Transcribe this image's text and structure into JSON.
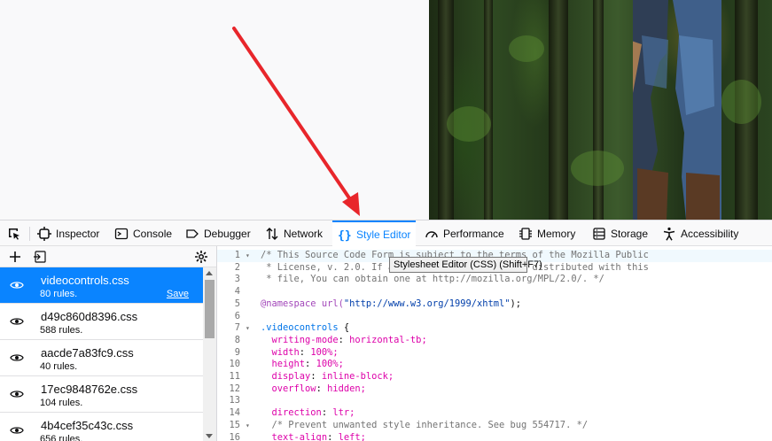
{
  "toolbar": {
    "tabs": [
      {
        "label": "Inspector",
        "icon": "inspector-icon"
      },
      {
        "label": "Console",
        "icon": "console-icon"
      },
      {
        "label": "Debugger",
        "icon": "debugger-icon"
      },
      {
        "label": "Network",
        "icon": "network-icon"
      },
      {
        "label": "Style Editor",
        "icon": "style-editor-icon",
        "selected": true
      },
      {
        "label": "Performance",
        "icon": "performance-icon"
      },
      {
        "label": "Memory",
        "icon": "memory-icon"
      },
      {
        "label": "Storage",
        "icon": "storage-icon"
      },
      {
        "label": "Accessibility",
        "icon": "accessibility-icon"
      }
    ]
  },
  "tooltip": {
    "text": "Stylesheet Editor (CSS) (Shift+F7)"
  },
  "sidebar": {
    "sheets": [
      {
        "name": "videocontrols.css",
        "rules": "80 rules.",
        "save": "Save",
        "selected": true
      },
      {
        "name": "d49c860d8396.css",
        "rules": "588 rules."
      },
      {
        "name": "aacde7a83fc9.css",
        "rules": "40 rules."
      },
      {
        "name": "17ec9848762e.css",
        "rules": "104 rules."
      },
      {
        "name": "4b4cef35c43c.css",
        "rules": "656 rules."
      }
    ]
  },
  "editor": {
    "lines": [
      {
        "n": "1",
        "text": "/* This Source Code Form is subject to the terms of the Mozilla Public"
      },
      {
        "n": "2",
        "text": " * License, v. 2.0. If a copy of the MPL was not distributed with this"
      },
      {
        "n": "3",
        "text": " * file, You can obtain one at http://mozilla.org/MPL/2.0/. */"
      },
      {
        "n": "4",
        "text": ""
      },
      {
        "n": "5",
        "at": "@namespace url(",
        "str": "\"http://www.w3.org/1999/xhtml\"",
        "tail": ");"
      },
      {
        "n": "6",
        "text": ""
      },
      {
        "n": "7",
        "sel": ".videocontrols",
        "tail": " {"
      },
      {
        "n": "8",
        "prop": "  writing-mode",
        "val": " horizontal-tb;"
      },
      {
        "n": "9",
        "prop": "  width",
        "val": " 100%;"
      },
      {
        "n": "10",
        "prop": "  height",
        "val": " 100%;"
      },
      {
        "n": "11",
        "prop": "  display",
        "val": " inline-block;"
      },
      {
        "n": "12",
        "prop": "  overflow",
        "val": " hidden;"
      },
      {
        "n": "13",
        "text": ""
      },
      {
        "n": "14",
        "prop": "  direction",
        "val": " ltr;"
      },
      {
        "n": "15",
        "comment": "  /* Prevent unwanted style inheritance. See bug 554717. */"
      },
      {
        "n": "16",
        "prop": "  text-align",
        "val": " left;"
      }
    ]
  },
  "colors": {
    "accent": "#0a84ff",
    "arrow": "#e8262b"
  }
}
